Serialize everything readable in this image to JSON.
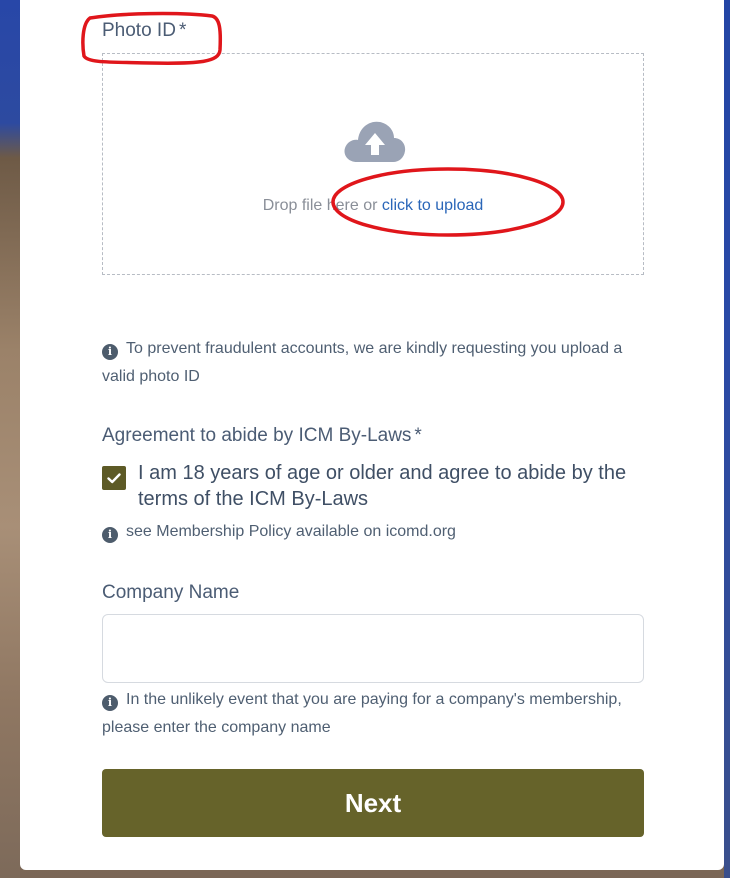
{
  "photo_id": {
    "label": "Photo ID",
    "required_mark": "*",
    "drop_text": "Drop file here or ",
    "upload_link": "click to upload",
    "icon": "cloud-upload-icon"
  },
  "photo_id_hint": "To prevent fraudulent accounts, we are kindly requesting you upload a valid photo ID",
  "bylaws": {
    "label": "Agreement to abide by ICM By-Laws",
    "required_mark": "*",
    "checkbox_text": "I am 18 years of age or older and agree to abide by the terms of the ICM By-Laws",
    "checked": true,
    "hint": "see Membership Policy available on icomd.org"
  },
  "company": {
    "label": "Company Name",
    "value": "",
    "hint": "In the unlikely event that you are paying for a company's membership, please enter the company name"
  },
  "next_button": {
    "label": "Next"
  },
  "colors": {
    "accent": "#66632a",
    "link": "#2a66b8",
    "annotation": "#e0161b"
  }
}
